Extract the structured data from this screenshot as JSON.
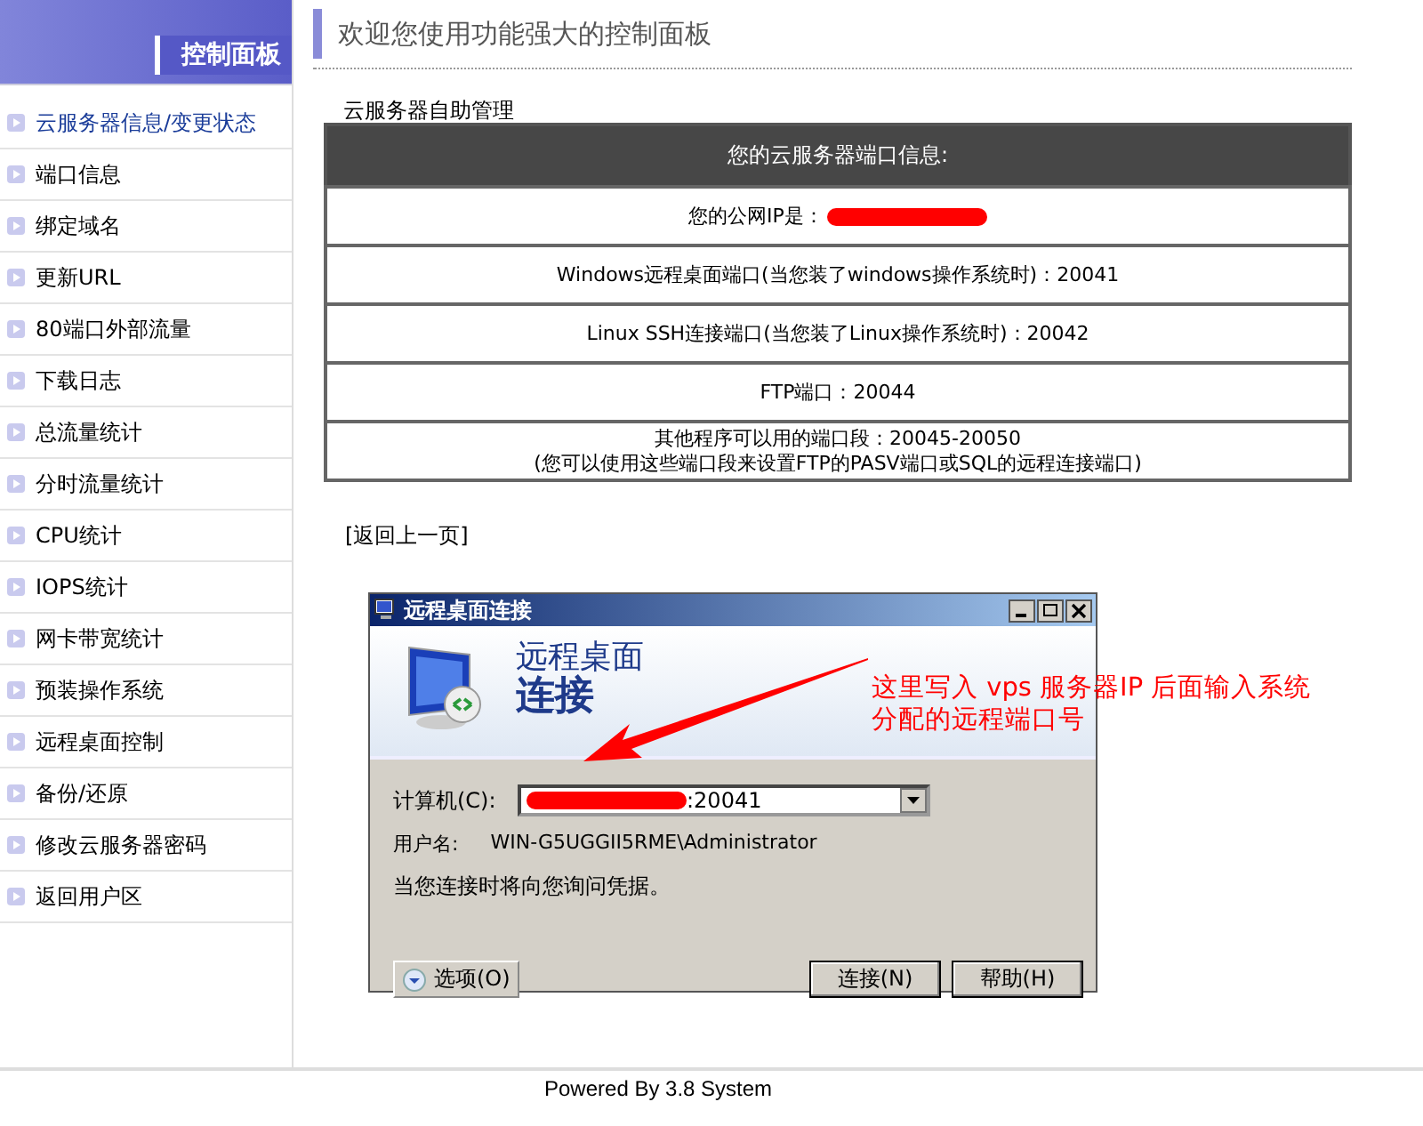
{
  "sidebar": {
    "title": "控制面板",
    "items": [
      {
        "label": "云服务器信息/变更状态",
        "selected": true
      },
      {
        "label": "端口信息",
        "selected": false
      },
      {
        "label": "绑定域名",
        "selected": false
      },
      {
        "label": "更新URL",
        "selected": false
      },
      {
        "label": "80端口外部流量",
        "selected": false
      },
      {
        "label": "下载日志",
        "selected": false
      },
      {
        "label": "总流量统计",
        "selected": false
      },
      {
        "label": "分时流量统计",
        "selected": false
      },
      {
        "label": "CPU统计",
        "selected": false
      },
      {
        "label": "IOPS统计",
        "selected": false
      },
      {
        "label": "网卡带宽统计",
        "selected": false
      },
      {
        "label": "预装操作系统",
        "selected": false
      },
      {
        "label": "远程桌面控制",
        "selected": false
      },
      {
        "label": "备份/还原",
        "selected": false
      },
      {
        "label": "修改云服务器密码",
        "selected": false
      },
      {
        "label": "返回用户区",
        "selected": false
      }
    ]
  },
  "page_title": "欢迎您使用功能强大的控制面板",
  "section_title": "云服务器自助管理",
  "port_table": {
    "header": "您的云服务器端口信息:",
    "rows": [
      {
        "kind": "redacted",
        "lines": [
          "您的公网IP是："
        ]
      },
      {
        "kind": "text",
        "lines": [
          "Windows远程桌面端口(当您装了windows操作系统时)：20041"
        ]
      },
      {
        "kind": "text",
        "lines": [
          "Linux SSH连接端口(当您装了Linux操作系统时)：20042"
        ]
      },
      {
        "kind": "text",
        "lines": [
          "FTP端口：20044"
        ]
      },
      {
        "kind": "text",
        "lines": [
          "其他程序可以用的端口段：20045-20050",
          "(您可以使用这些端口段来设置FTP的PASV端口或SQL的远程连接端口)"
        ]
      }
    ]
  },
  "back_link": "[返回上一页]",
  "dialog": {
    "title": "远程桌面连接",
    "banner_line1": "远程桌面",
    "banner_line2": "连接",
    "computer_label": "计算机(C):",
    "computer_value": ":20041",
    "user_label": "用户名:",
    "user_value": "WIN-G5UGGII5RME\\Administrator",
    "note": "当您连接时将向您询问凭据。",
    "options_button": "选项(O)",
    "buttons": [
      "连接(N)",
      "帮助(H)"
    ]
  },
  "annotation": {
    "lines": [
      "这里写入 vps 服务器IP 后面输入系统",
      "分配的远程端口号"
    ]
  },
  "footer": "Powered By 3.8 System"
}
